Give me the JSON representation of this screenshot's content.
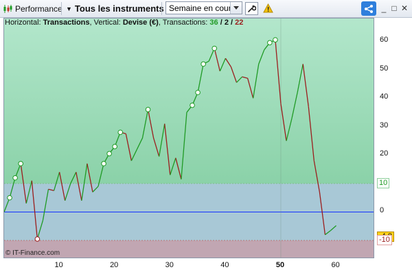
{
  "toolbar": {
    "performance_label": "Performance",
    "instruments_label": "Tous les instruments",
    "period_value": "Semaine en cours",
    "minimize": "_",
    "maximize": "□",
    "close": "✕"
  },
  "info": {
    "prefix": "Horizontal:",
    "horizontal": "Transactions",
    "vertical_prefix": ", Vertical:",
    "vertical": "Devise (€)",
    "tx_prefix": ", Transactions:",
    "tx_total": "36",
    "sep1": "/",
    "tx_win": "2",
    "sep2": "/",
    "tx_loss": "22"
  },
  "copyright": "© IT-Finance.com",
  "markers": {
    "upper": "10",
    "current": "-4,8",
    "lower": "-10"
  },
  "colors": {
    "up_zone": "#a6dfc1",
    "mid_zone": "#a8c8d6",
    "down_zone": "#c1a6b2",
    "up_line": "#1f9a24",
    "down_line": "#9b1d1d",
    "zero_line": "#1230ff"
  },
  "chart_data": {
    "type": "line",
    "x": [
      0,
      1,
      2,
      3,
      4,
      5,
      6,
      7,
      8,
      9,
      10,
      11,
      12,
      13,
      14,
      15,
      16,
      17,
      18,
      19,
      20,
      21,
      22,
      23,
      24,
      25,
      26,
      27,
      28,
      29,
      30,
      31,
      32,
      33,
      34,
      35,
      36,
      37,
      38,
      39,
      40,
      41,
      42,
      43,
      44,
      45,
      46,
      47,
      48,
      49,
      50,
      51,
      52,
      53,
      54,
      55,
      56,
      57,
      58,
      59,
      60
    ],
    "values": [
      0,
      5,
      12,
      17,
      3,
      11,
      -9.5,
      -3,
      8,
      7.5,
      14,
      4,
      10,
      14,
      4,
      17,
      7,
      9,
      17,
      20.5,
      23,
      28,
      27.5,
      18,
      22,
      26,
      36,
      26,
      19.5,
      31,
      13,
      19,
      11.5,
      35,
      37.5,
      42,
      52,
      53,
      57.5,
      49.5,
      54,
      51,
      45.5,
      47.5,
      47,
      40,
      52,
      57,
      59.5,
      60.5,
      38,
      25,
      33,
      42,
      52,
      37,
      18,
      7,
      -8,
      -6.5,
      -4.8
    ],
    "circled_points": [
      1,
      2,
      3,
      6,
      18,
      19,
      20,
      21,
      26,
      34,
      35,
      36,
      38,
      48,
      49
    ],
    "xlim": [
      0,
      67
    ],
    "ylim": [
      -16.5,
      68
    ],
    "xticks": [
      10,
      20,
      30,
      40,
      50,
      60
    ],
    "yticks": [
      60,
      50,
      40,
      30,
      20,
      10,
      0,
      -10
    ],
    "bold_xtick": 50,
    "reference_lines": [
      10,
      0,
      -10
    ]
  }
}
